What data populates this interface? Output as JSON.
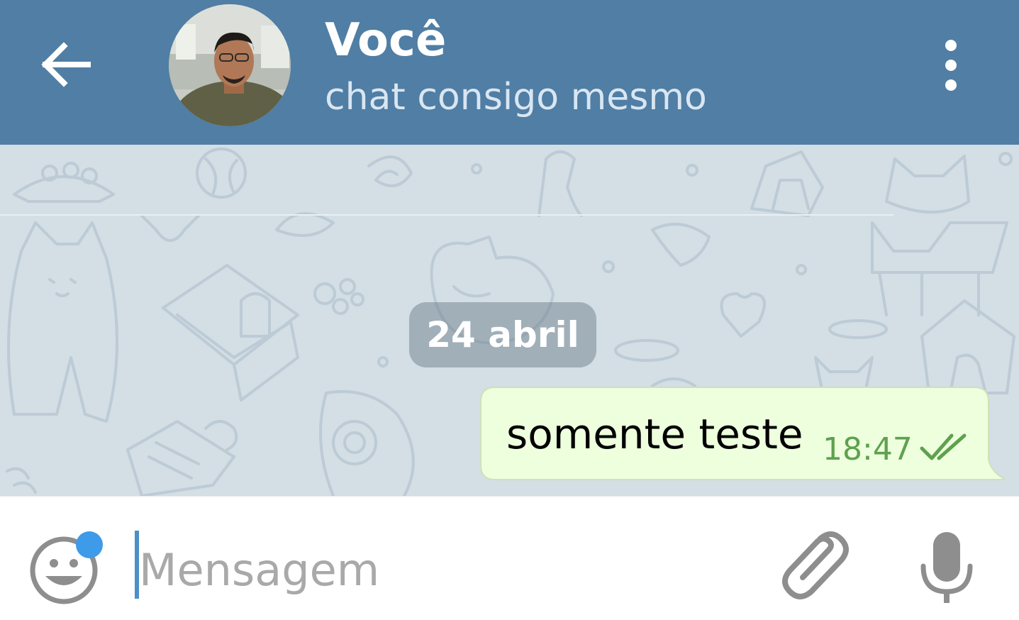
{
  "header": {
    "title": "Você",
    "subtitle": "chat consigo mesmo"
  },
  "chat": {
    "date_label": "24 abril",
    "messages": [
      {
        "text": "somente teste",
        "time": "18:47",
        "status": "read",
        "direction": "outgoing"
      }
    ]
  },
  "input": {
    "placeholder": "Mensagem",
    "value": ""
  },
  "icons": {
    "back": "arrow-left-icon",
    "menu": "more-vertical-icon",
    "emoji": "smiley-icon",
    "attach": "paperclip-icon",
    "mic": "microphone-icon",
    "check": "double-check-icon"
  },
  "colors": {
    "header_bg": "#507ea4",
    "chat_bg": "#d3dee5",
    "bubble_out": "#eeffde",
    "time_green": "#5ea14e",
    "emoji_badge": "#3d9be9"
  }
}
